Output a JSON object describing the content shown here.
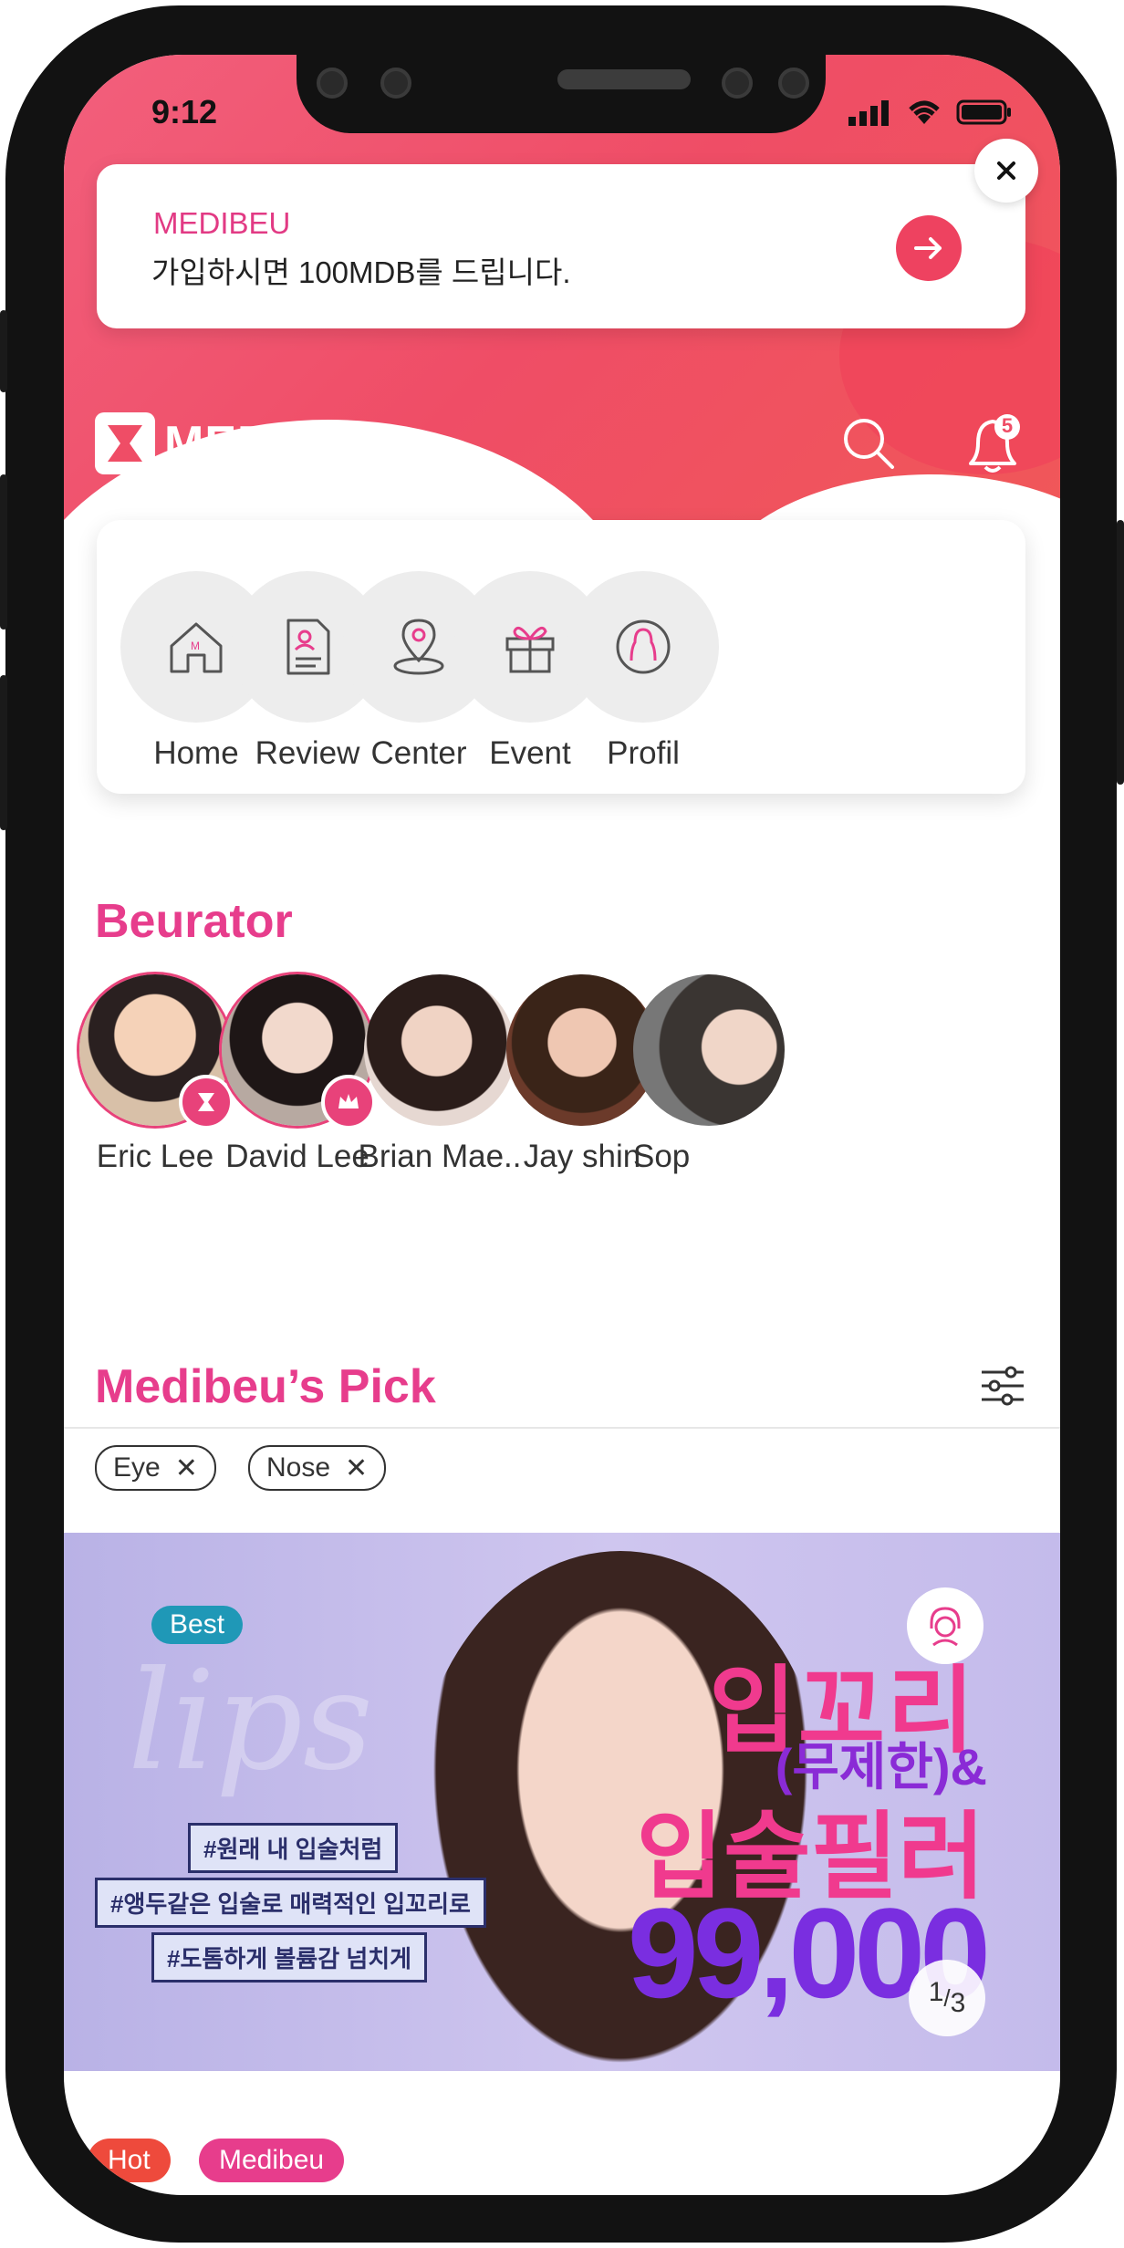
{
  "status_bar": {
    "time": "9:12"
  },
  "notification": {
    "brand": "MEDIBEU",
    "message": "가입하시면 100MDB를 드립니다."
  },
  "header": {
    "logo_text": "MEDIBEU",
    "notification_count": "5"
  },
  "menu": [
    {
      "label": "Home",
      "icon": "home-icon"
    },
    {
      "label": "Review",
      "icon": "document-icon"
    },
    {
      "label": "Center",
      "icon": "location-pin-icon"
    },
    {
      "label": "Event",
      "icon": "gift-icon"
    },
    {
      "label": "Profil",
      "icon": "profile-icon"
    }
  ],
  "beurator": {
    "title": "Beurator",
    "people": [
      {
        "name": "Eric Lee",
        "badge": "brand-badge"
      },
      {
        "name": "David Lee",
        "badge": "crown-badge"
      },
      {
        "name": "Brian Mae.."
      },
      {
        "name": "Jay shin"
      },
      {
        "name": "Sop"
      }
    ]
  },
  "pick": {
    "title": "Medibeu’s Pick",
    "chips": [
      "Eye",
      "Nose"
    ]
  },
  "banner": {
    "badge": "Best",
    "watermark": "lips",
    "tags": [
      "#원래 내 입술처럼",
      "#앵두같은 입술로 매력적인 입꼬리로",
      "#도톰하게 볼륨감 넘치게"
    ],
    "headline_1": "입꼬리",
    "headline_2": "(무제한)&",
    "headline_3": "입술필러",
    "price": "99,000",
    "page_current": "1",
    "page_total": "3"
  },
  "bottom_tags": [
    "Hot",
    "Medibeu"
  ],
  "colors": {
    "brand_pink": "#e73d8c",
    "hero_red": "#ef4d66",
    "hot_red": "#ee4a3c"
  }
}
